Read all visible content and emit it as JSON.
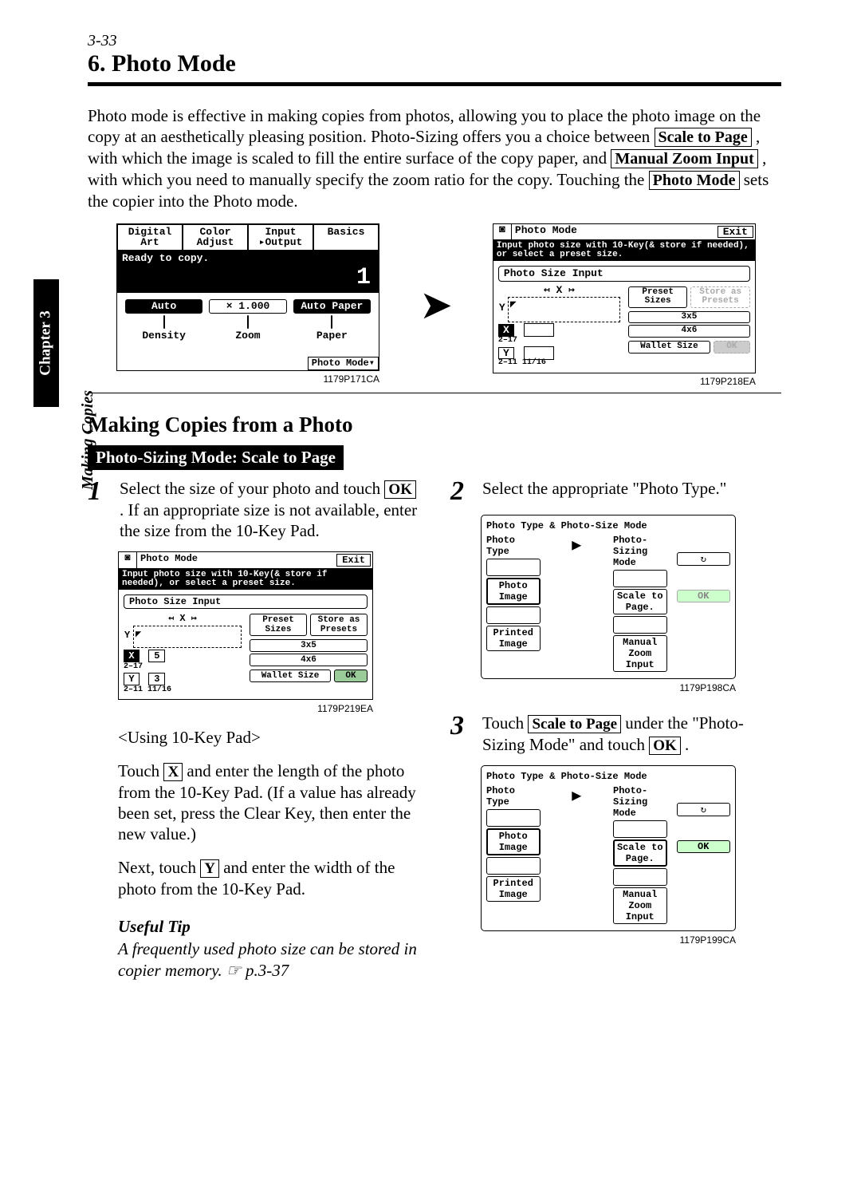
{
  "page_number": "3-33",
  "title": "6. Photo Mode",
  "intro": {
    "t1": "Photo mode is effective in making copies from photos, allowing you to place the photo image on the copy at an aesthetically pleasing position. Photo-Sizing offers you a choice between ",
    "box1": "Scale to Page",
    "t2": " , with which the image is scaled to fill the entire surface of the copy paper, and ",
    "box2": "Manual Zoom Input",
    "t3": " , with which you need to manually specify the zoom ratio for the copy. Touching the ",
    "box3": "Photo Mode",
    "t4": " sets the copier into the Photo mode."
  },
  "side": {
    "chapter": "Chapter 3",
    "label": "Making Copies"
  },
  "fig1": {
    "tabs": [
      "Digital Art",
      "Color Adjust",
      "Input ▸Output",
      "Basics"
    ],
    "ready": "Ready to copy.",
    "count": "1",
    "auto": "Auto",
    "zoomv": "× 1.000",
    "autopaper": "Auto Paper",
    "c1": "Density",
    "c2": "Zoom",
    "c3": "Paper",
    "pm": "Photo Mode▾",
    "cap": "1179P171CA"
  },
  "fig2": {
    "title": "Photo Mode",
    "exit": "Exit",
    "msg": "Input photo size with 10-Key(& store if needed), or select a preset size.",
    "sect": "Photo Size Input",
    "x": "X",
    "y": "Y",
    "preset": "Preset Sizes",
    "store": "Store as Presets",
    "s1": "3x5",
    "s2": "4x6",
    "s3": "Wallet Size",
    "ok": "OK",
    "rx": "2–17",
    "ry": "2–11 11/16",
    "cap": "1179P218EA"
  },
  "subhead": "Making Copies from a Photo",
  "blackbar": "Photo-Sizing Mode: Scale to Page",
  "step1": {
    "n": "1",
    "a": "Select the size of your photo and touch ",
    "ok": "OK",
    "b": " . If an appropriate size is not available, enter the size from the 10-Key Pad.",
    "figcap": "1179P219EA",
    "x": "X",
    "xv": "5",
    "y": "Y",
    "yv": "3",
    "using": "<Using 10-Key Pad>",
    "p1a": "Touch ",
    "p1x": "X",
    "p1b": " and enter the length of the photo from the 10-Key Pad. (If a value has already been set, press the Clear Key, then enter the new value.)",
    "p2a": "Next, touch ",
    "p2y": "Y",
    "p2b": " and enter the width of the photo from the 10-Key Pad.",
    "useful": "Useful Tip",
    "tip": "A frequently used photo size can be stored in copier memory. ☞ p.3-37"
  },
  "step2": {
    "n": "2",
    "a": "Select the appropriate \"Photo Type.\"",
    "panel": {
      "hdr": "Photo Type & Photo-Size Mode",
      "h1": "Photo Type",
      "h2": "Photo-Sizing Mode",
      "pi": "Photo Image",
      "pr": "Printed Image",
      "sp": "Scale to Page.",
      "mz": "Manual Zoom Input",
      "ok": "OK",
      "rot": "↻"
    },
    "cap": "1179P198CA"
  },
  "step3": {
    "n": "3",
    "a": "Touch ",
    "box": "Scale to Page",
    "b": " under the \"Photo-Sizing Mode\" and touch ",
    "ok": "OK",
    "c": " .",
    "cap": "1179P199CA"
  }
}
